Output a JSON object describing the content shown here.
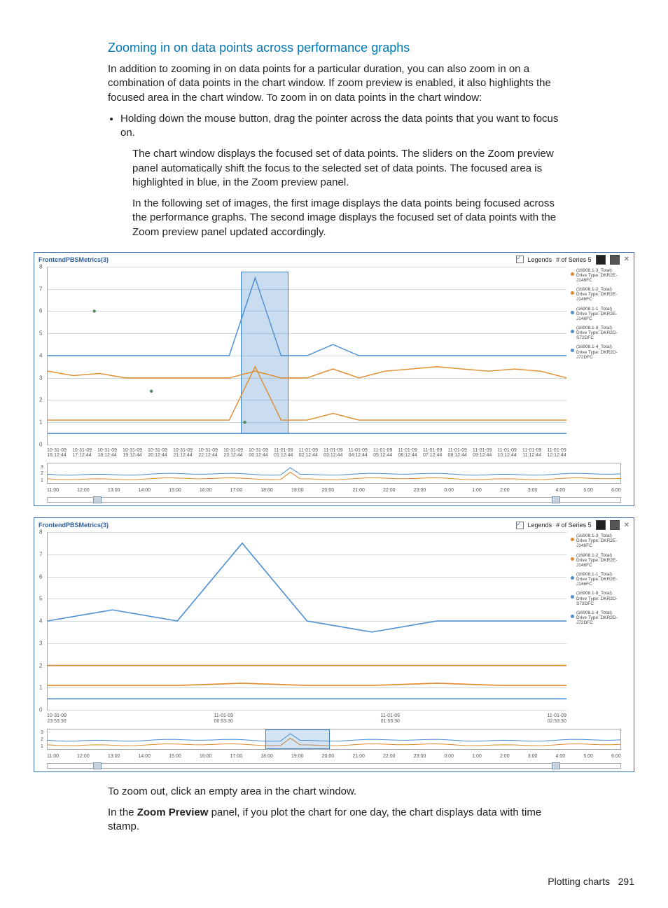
{
  "heading": "Zooming in on data points across performance graphs",
  "para_intro": "In addition to zooming in on data points for a particular duration, you can also zoom in on a combination of data points in the chart window. If zoom preview is enabled, it also highlights the focused area in the chart window. To zoom in on data points in the chart window:",
  "bullet1": "Holding down the mouse button, drag the pointer across the data points that you want to focus on.",
  "inset1": "The chart window displays the focused set of data points. The sliders on the Zoom preview panel automatically shift the focus to the selected set of data points. The focused area is highlighted in blue, in the Zoom preview panel.",
  "inset2": "In the following set of images, the first image displays the data points being focused across the performance graphs. The second image displays the focused set of data points with the Zoom preview panel updated accordingly.",
  "para_after1": "To zoom out, click an empty area in the chart window.",
  "para_after2_a": "In the ",
  "para_after2_b": "Zoom Preview",
  "para_after2_c": " panel, if you plot the chart for one day, the chart displays data with time stamp.",
  "footer_label": "Plotting charts",
  "footer_page": "291",
  "chart_title": "FrontendPBSMetrics(3)",
  "toolbar": {
    "legends_label": "Legends",
    "series_label": "# of Series 5"
  },
  "legend_items": [
    {
      "name": "(16908.1-3_Total)",
      "sub": "Drive Type: DKR2E-J146FC",
      "color": "#e08a2a"
    },
    {
      "name": "(16908.1-2_Total)",
      "sub": "Drive Type: DKR2E-J146FC",
      "color": "#e08a2a"
    },
    {
      "name": "(16908.1-1_Total)",
      "sub": "Drive Type: DKR2E-J146FC",
      "color": "#4a8dd1"
    },
    {
      "name": "(16908.1-8_Total)",
      "sub": "Drive Type: DKR2D-S72DFC",
      "color": "#4a8dd1"
    },
    {
      "name": "(16908.1-4_Total)",
      "sub": "Drive Type: DKR2D-J72DFC",
      "color": "#4a8dd1"
    }
  ],
  "chart_data": [
    {
      "type": "line",
      "title": "FrontendPBSMetrics(3) — full range with selection",
      "ylim": [
        0,
        8
      ],
      "yticks": [
        "0",
        "1",
        "2",
        "3",
        "4",
        "5",
        "6",
        "7",
        "8"
      ],
      "x_labels_top": [
        "10-31-09",
        "10-31-09",
        "10-31-09",
        "10-31-09",
        "10-31-09",
        "10-31-09",
        "10-31-09",
        "10-31-09",
        "10-31-09",
        "11-01-09",
        "11-01-09",
        "11-01-09",
        "11-01-09",
        "11-01-09",
        "11-01-09",
        "11-01-09",
        "11-01-09",
        "11-01-09",
        "11-01-09",
        "11-01-09",
        "11-01-09"
      ],
      "x_labels_bot": [
        "16:12:44",
        "17:12:44",
        "18:12:44",
        "19:12:44",
        "20:12:44",
        "21:12:44",
        "22:12:44",
        "23:12:44",
        "00:12:44",
        "01:12:44",
        "02:12:44",
        "03:12:44",
        "04:12:44",
        "05:12:44",
        "06:12:44",
        "07:12:44",
        "08:12:44",
        "09:12:44",
        "10:12:44",
        "11:12:44",
        "12:12:44"
      ],
      "preview_xticks": [
        "11:00",
        "12:00",
        "13:00",
        "14:00",
        "15:00",
        "16:00",
        "17:00",
        "18:00",
        "19:00",
        "20:00",
        "21:00",
        "22:00",
        "23:00",
        "0:00",
        "1:00",
        "2:00",
        "3:00",
        "4:00",
        "5:00",
        "6:00"
      ],
      "preview_yticks": [
        "3",
        "2",
        "1"
      ],
      "selection_x_fraction": [
        0.372,
        0.462
      ],
      "series": [
        {
          "name": "blue-upper",
          "color": "#4a8dd1",
          "values": [
            4.0,
            4.0,
            4.0,
            4.0,
            4.0,
            4.0,
            4.0,
            4.0,
            7.5,
            4.0,
            4.0,
            4.5,
            4.0,
            4.0,
            4.0,
            4.0,
            4.0,
            4.0,
            4.0,
            4.0,
            4.0
          ]
        },
        {
          "name": "orange-mid",
          "color": "#e08a2a",
          "values": [
            3.3,
            3.1,
            3.2,
            3.0,
            3.0,
            3.0,
            3.0,
            3.0,
            3.3,
            3.0,
            3.0,
            3.4,
            3.0,
            3.3,
            3.4,
            3.5,
            3.4,
            3.3,
            3.4,
            3.3,
            3.0
          ]
        },
        {
          "name": "orange-low",
          "color": "#e08a2a",
          "values": [
            1.1,
            1.1,
            1.1,
            1.1,
            1.1,
            1.1,
            1.1,
            1.1,
            3.5,
            1.1,
            1.1,
            1.4,
            1.1,
            1.1,
            1.1,
            1.1,
            1.1,
            1.1,
            1.1,
            1.1,
            1.1
          ]
        },
        {
          "name": "blue-low",
          "color": "#4a8dd1",
          "values": [
            0.5,
            0.5,
            0.5,
            0.5,
            0.5,
            0.5,
            0.5,
            0.5,
            0.5,
            0.5,
            0.5,
            0.5,
            0.5,
            0.5,
            0.5,
            0.5,
            0.5,
            0.5,
            0.5,
            0.5,
            0.5
          ]
        }
      ],
      "scatter": {
        "color": "#4f8a59",
        "points_xy": [
          [
            0.09,
            6.0
          ],
          [
            0.2,
            2.4
          ],
          [
            0.38,
            1.0
          ]
        ]
      }
    },
    {
      "type": "line",
      "title": "FrontendPBSMetrics(3) — zoomed selection",
      "ylim": [
        0,
        8
      ],
      "yticks": [
        "0",
        "1",
        "2",
        "3",
        "4",
        "5",
        "6",
        "7",
        "8"
      ],
      "x_labels_top": [
        "10-31-09",
        "11-01-09",
        "11-01-09",
        "11-01-09"
      ],
      "x_labels_bot": [
        "23:53:30",
        "00:53:30",
        "01:53:30",
        "02:53:30"
      ],
      "preview_xticks": [
        "11:00",
        "12:00",
        "13:00",
        "14:00",
        "15:00",
        "16:00",
        "17:00",
        "18:00",
        "19:00",
        "20:00",
        "21:00",
        "22:00",
        "23:00",
        "0:00",
        "1:00",
        "2:00",
        "3:00",
        "4:00",
        "5:00",
        "6:00"
      ],
      "preview_yticks": [
        "3",
        "2",
        "1"
      ],
      "preview_selection_fraction": [
        0.38,
        0.49
      ],
      "series": [
        {
          "name": "blue-upper",
          "color": "#4a8dd1",
          "values": [
            4.0,
            4.5,
            4.0,
            7.5,
            4.0,
            3.5,
            4.0,
            4.0,
            4.0
          ]
        },
        {
          "name": "orange-mid",
          "color": "#e08a2a",
          "values": [
            2.0,
            2.0,
            2.0,
            2.0,
            2.0,
            2.0,
            2.0,
            2.0,
            2.0
          ]
        },
        {
          "name": "orange-low",
          "color": "#e08a2a",
          "values": [
            1.1,
            1.1,
            1.1,
            1.2,
            1.1,
            1.1,
            1.2,
            1.1,
            1.1
          ]
        },
        {
          "name": "blue-low",
          "color": "#4a8dd1",
          "values": [
            0.5,
            0.5,
            0.5,
            0.5,
            0.5,
            0.5,
            0.5,
            0.5,
            0.5
          ]
        }
      ]
    }
  ]
}
